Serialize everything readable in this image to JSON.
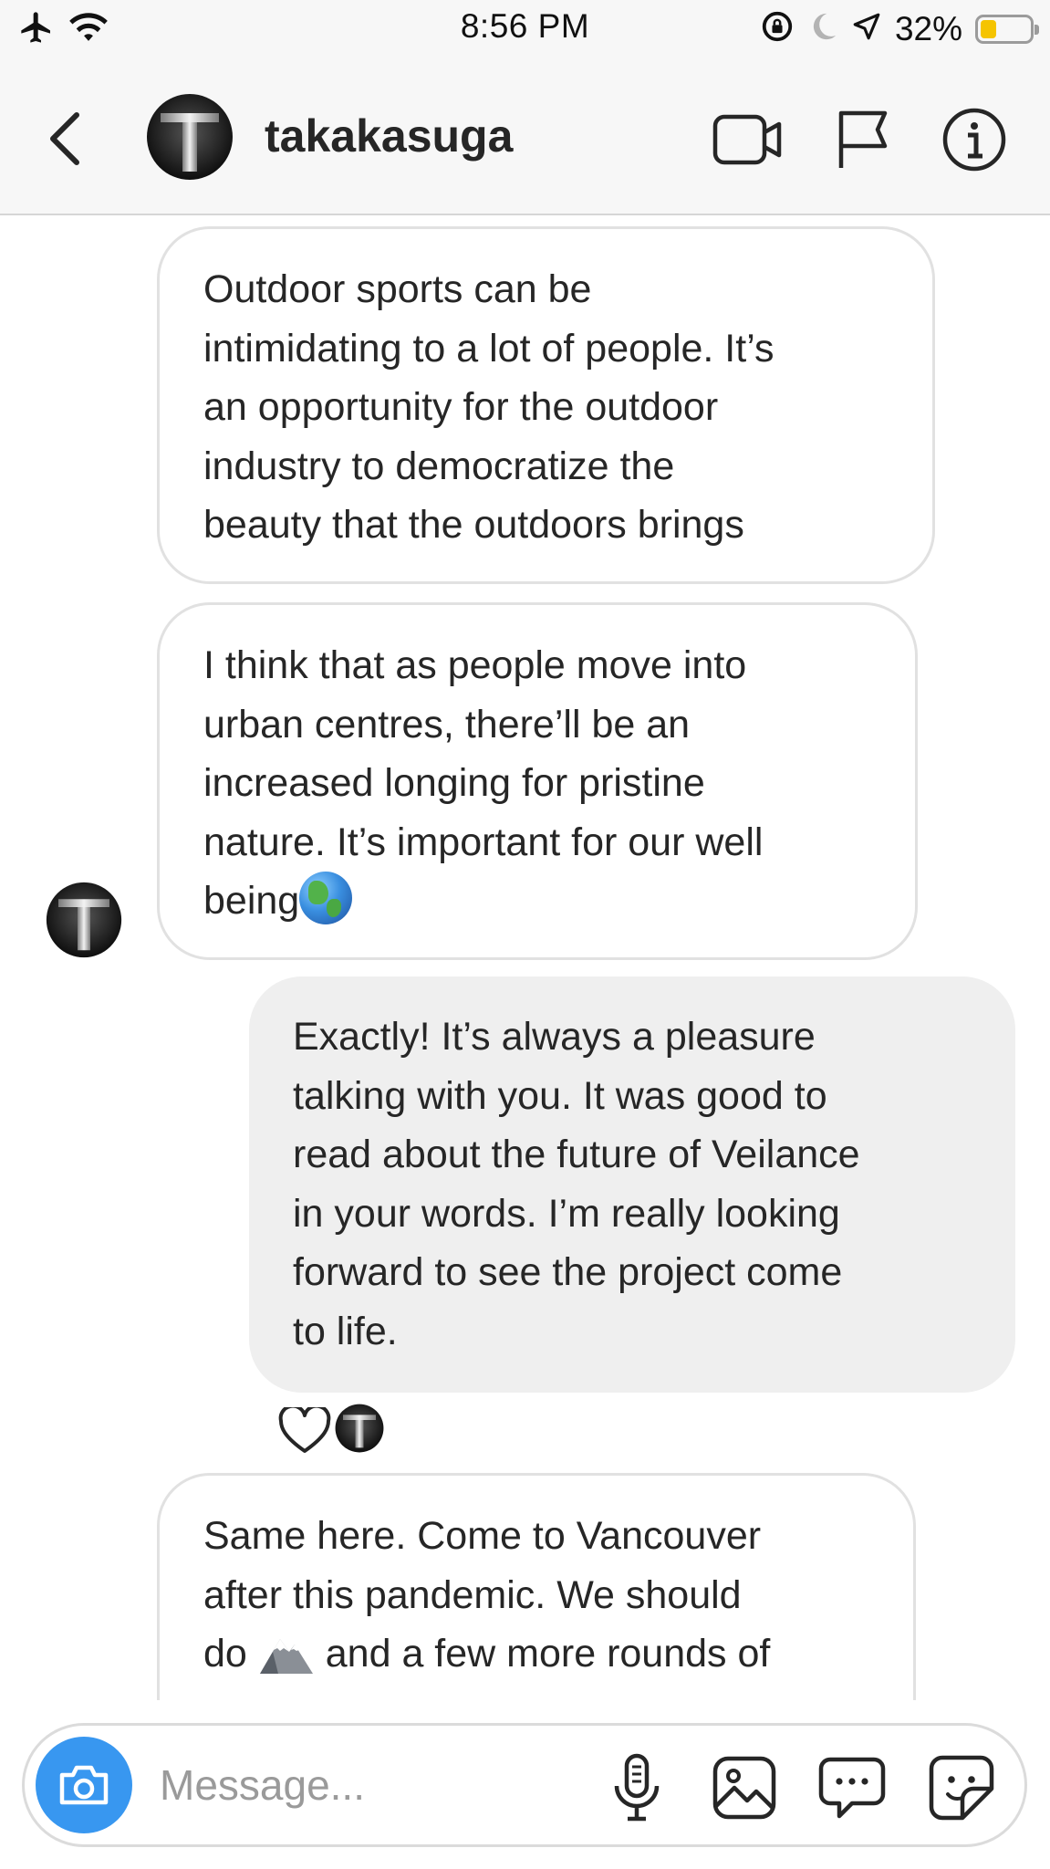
{
  "status_bar": {
    "time": "8:56 PM",
    "battery_percent": "32%",
    "battery_level": 0.32,
    "icons": [
      "airplane-icon",
      "wifi-icon",
      "orientation-lock-icon",
      "moon-icon",
      "location-arrow-icon",
      "battery-icon"
    ]
  },
  "header": {
    "username": "takakasuga",
    "icons": [
      "back-chevron-icon",
      "video-call-icon",
      "flag-icon",
      "info-icon"
    ]
  },
  "messages": [
    {
      "direction": "incoming",
      "lines": [
        "Outdoor sports can be",
        "intimidating to a lot of people. It’s",
        "an opportunity for the outdoor",
        "industry to democratize the",
        "beauty that the outdoors brings"
      ]
    },
    {
      "direction": "incoming",
      "lines": [
        "I think that as people move into",
        "urban centres, there’ll be an",
        "increased longing for pristine",
        "nature. It’s important for our well",
        "being"
      ],
      "emoji": "globe-emoji"
    },
    {
      "direction": "outgoing",
      "lines": [
        "Exactly! It’s always a pleasure",
        "talking with you. It was good to",
        "read about the future of Veilance",
        "in your words. I’m really looking",
        "forward to see the project come",
        "to life."
      ],
      "reaction": "heart-icon"
    },
    {
      "direction": "incoming",
      "lines": [
        "Same here. Come to Vancouver",
        "after this pandemic. We should",
        "do",
        "and a few more rounds of"
      ],
      "emoji": "mountain-emoji"
    }
  ],
  "composer": {
    "placeholder": "Message...",
    "icons": [
      "camera-icon",
      "microphone-icon",
      "gallery-icon",
      "chat-bubble-icon",
      "sticker-icon"
    ]
  },
  "colors": {
    "accent_blue": "#3897f0",
    "outgoing_bubble": "#efefef",
    "incoming_border": "#e1e1e1",
    "header_bg": "#f7f7f7",
    "battery_yellow": "#f5c400"
  }
}
